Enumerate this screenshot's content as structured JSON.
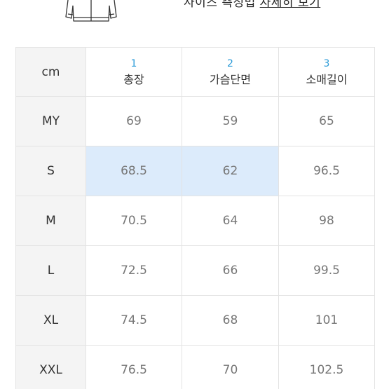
{
  "header": {
    "note_prefix": "사이즈 측정법",
    "note_link": "자세히 보기"
  },
  "colors": {
    "accent": "#2b9bd8",
    "highlight": "#dcebfb",
    "header_bg": "#f4f4f4",
    "border": "#e3e3e3"
  },
  "table": {
    "unit_label": "cm",
    "columns": [
      {
        "num": "1",
        "label": "총장"
      },
      {
        "num": "2",
        "label": "가슴단면"
      },
      {
        "num": "3",
        "label": "소매길이"
      }
    ],
    "rows": [
      {
        "size": "MY",
        "values": [
          "69",
          "59",
          "65"
        ],
        "highlight": [
          false,
          false,
          false
        ]
      },
      {
        "size": "S",
        "values": [
          "68.5",
          "62",
          "96.5"
        ],
        "highlight": [
          true,
          true,
          false
        ]
      },
      {
        "size": "M",
        "values": [
          "70.5",
          "64",
          "98"
        ],
        "highlight": [
          false,
          false,
          false
        ]
      },
      {
        "size": "L",
        "values": [
          "72.5",
          "66",
          "99.5"
        ],
        "highlight": [
          false,
          false,
          false
        ]
      },
      {
        "size": "XL",
        "values": [
          "74.5",
          "68",
          "101"
        ],
        "highlight": [
          false,
          false,
          false
        ]
      },
      {
        "size": "XXL",
        "values": [
          "76.5",
          "70",
          "102.5"
        ],
        "highlight": [
          false,
          false,
          false
        ]
      }
    ]
  }
}
